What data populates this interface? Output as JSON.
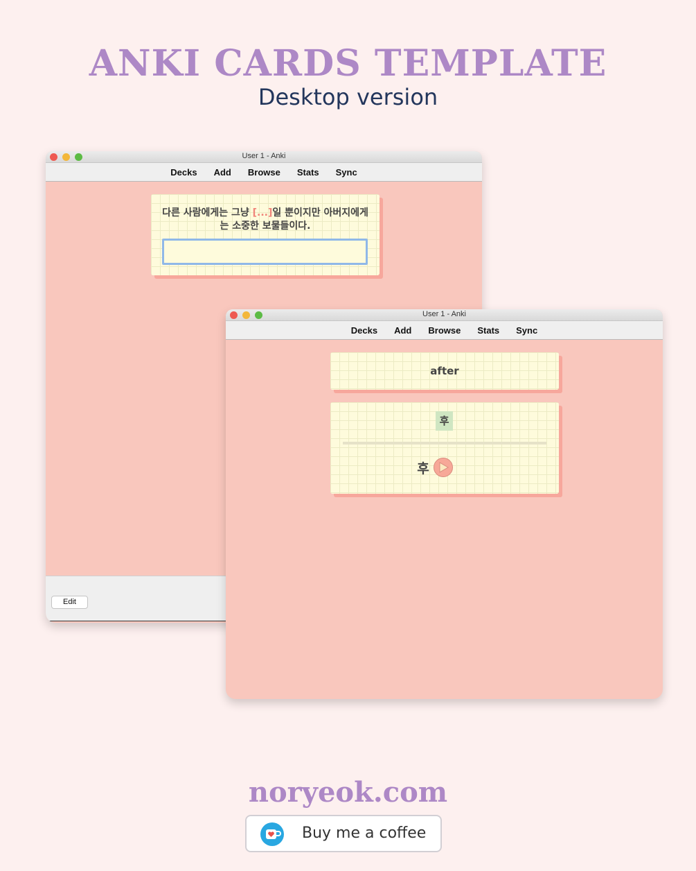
{
  "header": {
    "title": "ANKI CARDS TEMPLATE",
    "subtitle": "Desktop version"
  },
  "back_window": {
    "title": "User 1 - Anki",
    "menu": [
      "Decks",
      "Add",
      "Browse",
      "Stats",
      "Sync"
    ],
    "card": {
      "text_before": "다른 사람에게는 그냥 ",
      "cloze": "[...]",
      "text_after": "일 뿐이지만 아버지에게는 소중한 보물들이다.",
      "answer_value": ""
    },
    "edit_label": "Edit"
  },
  "front_window": {
    "title": "User 1 - Anki",
    "menu": [
      "Decks",
      "Add",
      "Browse",
      "Stats",
      "Sync"
    ],
    "front_card": {
      "word": "after"
    },
    "back_card": {
      "hangul": "후",
      "answer": "후"
    }
  },
  "footer": {
    "site": "noryeok.com",
    "coffee_label": "Buy me a coffee"
  },
  "colors": {
    "background": "#fdf0ef",
    "accent_purple": "#ad88c6",
    "window_pink": "#f9c7bd",
    "card_cream": "#fefbdc",
    "cloze_red": "#f0857a"
  },
  "icons": [
    "close-light-icon",
    "minimize-light-icon",
    "zoom-light-icon",
    "play-icon",
    "coffee-cup-icon"
  ]
}
